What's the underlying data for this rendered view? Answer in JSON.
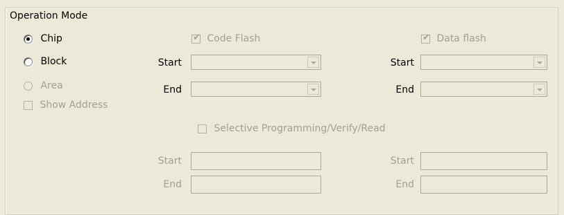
{
  "group": {
    "title": "Operation Mode"
  },
  "mode": {
    "chip": "Chip",
    "block": "Block",
    "area": "Area",
    "show_address": "Show Address"
  },
  "code_flash": {
    "label": "Code Flash",
    "checked": true,
    "start_label": "Start",
    "end_label": "End"
  },
  "data_flash": {
    "label": "Data flash",
    "checked": true,
    "start_label": "Start",
    "end_label": "End"
  },
  "selective": {
    "label": "Selective Programming/Verify/Read",
    "left_start_label": "Start",
    "left_end_label": "End",
    "right_start_label": "Start",
    "right_end_label": "End"
  }
}
